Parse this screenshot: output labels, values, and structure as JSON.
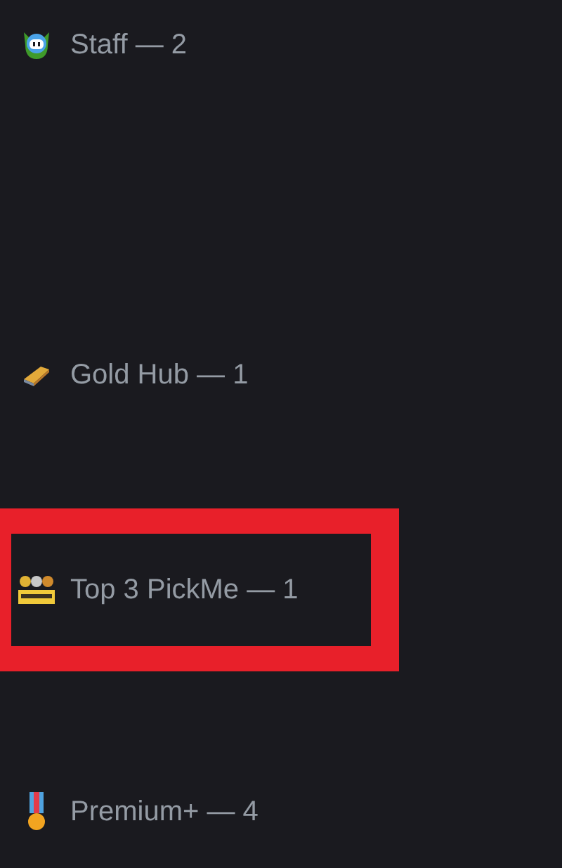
{
  "role_groups": [
    {
      "kind": "staff",
      "label": "Staff — 2",
      "highlighted": false
    },
    {
      "kind": "gold",
      "label": "Gold Hub — 1",
      "highlighted": false
    },
    {
      "kind": "top",
      "label": "Top 3 PickMe — 1",
      "highlighted": true
    },
    {
      "kind": "medal",
      "label": "Premium+ — 4",
      "highlighted": false
    }
  ]
}
